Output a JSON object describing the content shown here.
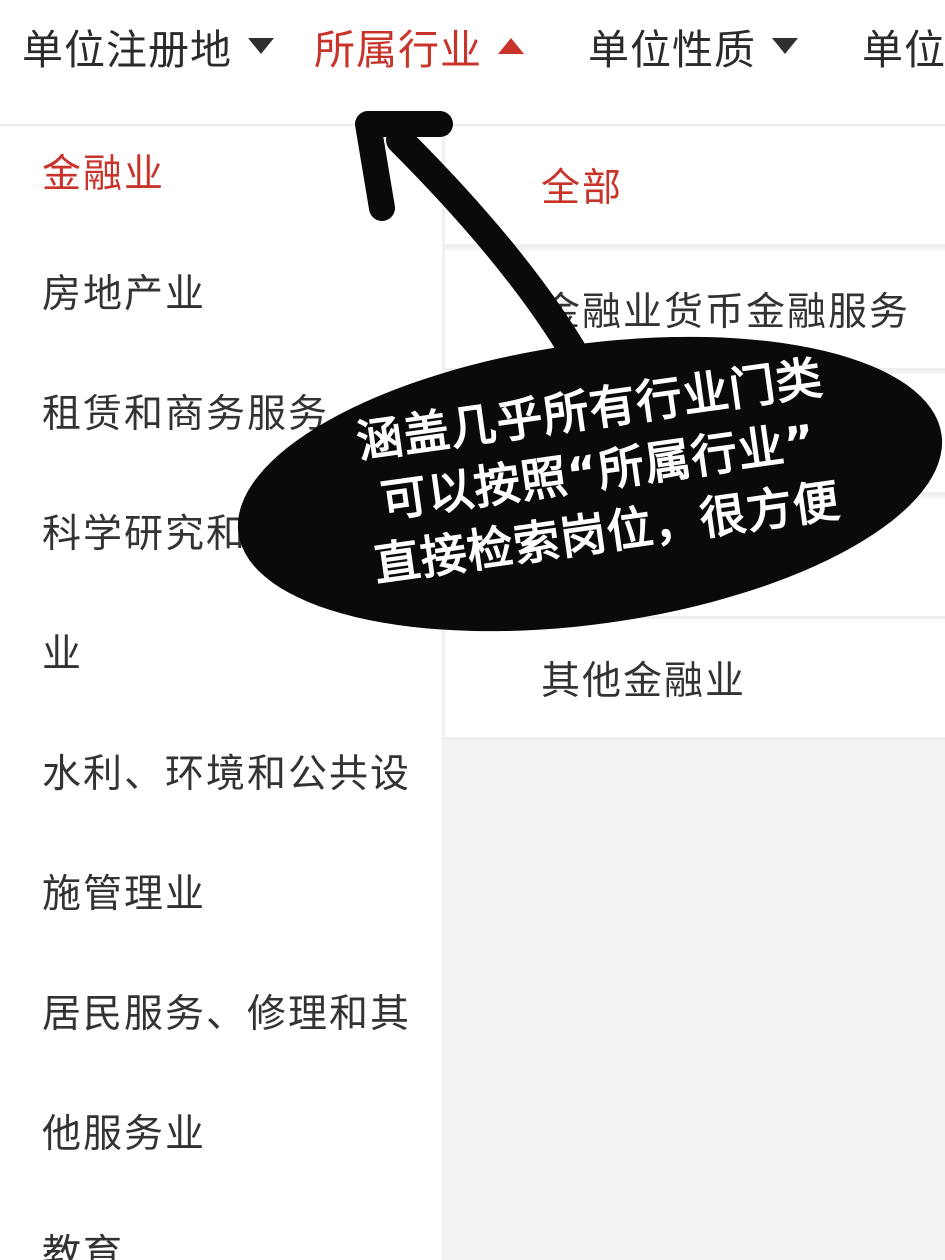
{
  "filter_bar": {
    "tabs": [
      {
        "label": "单位注册地",
        "state": "collapsed"
      },
      {
        "label": "所属行业",
        "state": "expanded"
      },
      {
        "label": "单位性质",
        "state": "collapsed"
      },
      {
        "label": "单位",
        "state": "collapsed"
      }
    ]
  },
  "industry_list": {
    "items": [
      "金融业",
      "房地产业",
      "租赁和商务服务",
      "科学研究和",
      "业",
      "水利、环境和公共设",
      "施管理业",
      "居民服务、修理和其",
      "他服务业",
      "教育"
    ],
    "selected": "金融业"
  },
  "sub_list": {
    "items": [
      "全部",
      "金融业货币金融服务",
      "",
      "",
      "其他金融业"
    ],
    "selected": "全部"
  },
  "annotation": {
    "lines": [
      "涵盖几乎所有行业门类",
      "可以按照“所属行业”",
      "直接检索岗位，很方便"
    ]
  },
  "colors": {
    "accent": "#c8332a",
    "text": "#333333",
    "panel_bg": "#f3f3f3",
    "bubble": "#0a0a0a"
  }
}
